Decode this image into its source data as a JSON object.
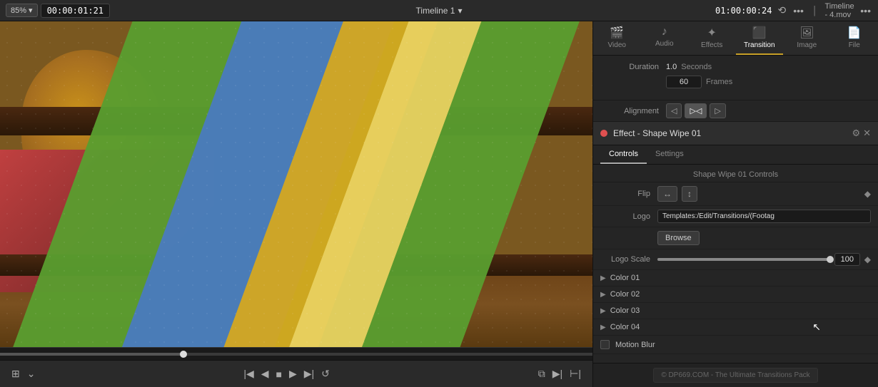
{
  "topBar": {
    "zoom": "85%",
    "timecode_left": "00:00:01:21",
    "timeline_label": "Timeline 1",
    "timecode_right": "01:00:00:24",
    "panel_title": "Timeline - 4.mov"
  },
  "inspector": {
    "tabs": [
      {
        "id": "video",
        "label": "Video",
        "icon": "🎬"
      },
      {
        "id": "audio",
        "label": "Audio",
        "icon": "🎵"
      },
      {
        "id": "effects",
        "label": "Effects",
        "icon": "✨"
      },
      {
        "id": "transition",
        "label": "Transition",
        "icon": "🔄",
        "active": true
      },
      {
        "id": "image",
        "label": "Image",
        "icon": "🖼"
      },
      {
        "id": "file",
        "label": "File",
        "icon": "📄"
      }
    ],
    "duration": {
      "label": "Duration",
      "value": "1.0",
      "unit": "Seconds",
      "frames": "60",
      "frames_label": "Frames"
    },
    "alignment": {
      "label": "Alignment",
      "options": [
        "◁",
        "▷|◁",
        "▷"
      ]
    }
  },
  "effect": {
    "name": "Effect - Shape Wipe 01",
    "sub_tabs": [
      "Controls",
      "Settings"
    ],
    "active_sub_tab": "Controls",
    "section_title": "Shape Wipe 01 Controls",
    "flip_label": "Flip",
    "logo_label": "Logo",
    "logo_path": "Templates:/Edit/Transitions/(Footag",
    "browse_btn": "Browse",
    "logo_scale_label": "Logo Scale",
    "logo_scale_value": "100",
    "colors": [
      {
        "label": "Color 01"
      },
      {
        "label": "Color 02"
      },
      {
        "label": "Color 03"
      },
      {
        "label": "Color 04"
      }
    ],
    "motion_blur_label": "Motion Blur"
  },
  "footer": {
    "text": "© DP669.COM - The Ultimate Transitions Pack"
  },
  "bottomControls": {
    "buttons": [
      "⊞",
      "⌄",
      "|◀",
      "◀",
      "■",
      "▶",
      "▶|",
      "↺",
      "⧉",
      "▶|",
      "⊢|"
    ]
  }
}
